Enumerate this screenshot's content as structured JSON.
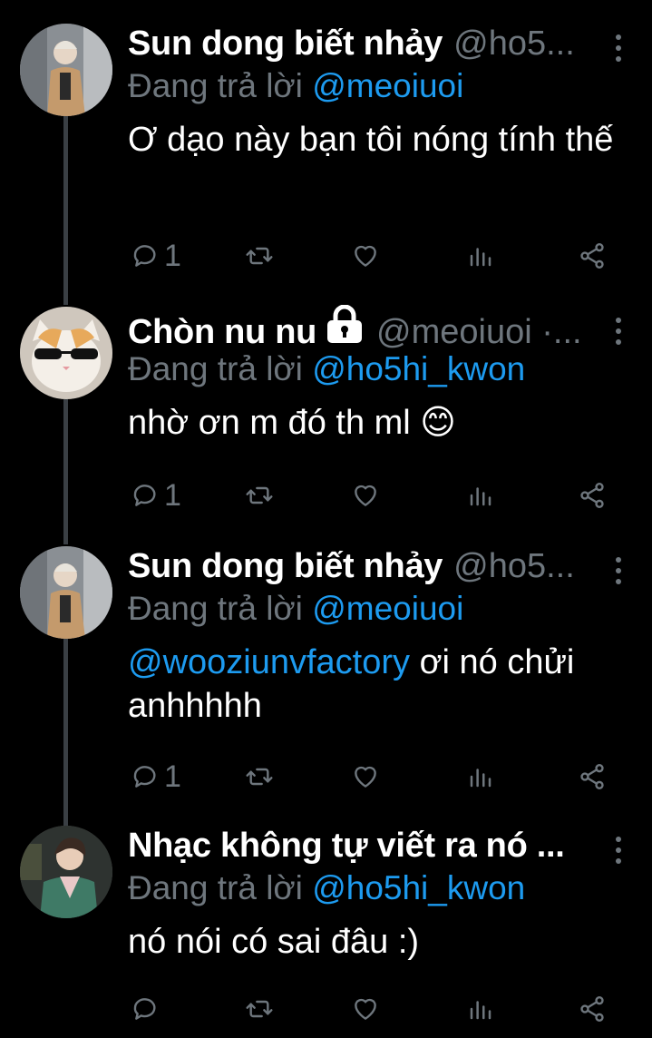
{
  "tweets": [
    {
      "name": "Sun dong biết nhảy",
      "handle": "@ho5...",
      "reply_prefix": "Đang trả lời",
      "reply_handle": "@meoiuoi",
      "text_mention": "",
      "text": "Ơ dạo này bạn tôi nóng tính thế",
      "reply_count": "1",
      "locked": false
    },
    {
      "name": "Chòn nu nu",
      "handle": "@meoiuoi ·...",
      "reply_prefix": "Đang trả lời",
      "reply_handle": "@ho5hi_kwon",
      "text_mention": "",
      "text": "nhờ ơn m đó th ml 😊",
      "reply_count": "1",
      "locked": true
    },
    {
      "name": "Sun dong biết nhảy",
      "handle": "@ho5...",
      "reply_prefix": "Đang trả lời",
      "reply_handle": "@meoiuoi",
      "text_mention": "@wooziunvfactory",
      "text": " ơi nó chửi anhhhhh",
      "reply_count": "1",
      "locked": false
    },
    {
      "name": "Nhạc không tự viết ra nó ...",
      "handle": "",
      "reply_prefix": "Đang trả lời",
      "reply_handle": "@ho5hi_kwon",
      "text_mention": "",
      "text": "nó nói có sai đâu :)",
      "reply_count": "",
      "locked": false
    }
  ],
  "colors": {
    "background": "#000000",
    "secondary_text": "#6e767d",
    "link": "#1d9bf0",
    "thread_line": "#3a3f44"
  },
  "icons": [
    "reply-icon",
    "retweet-icon",
    "like-icon",
    "views-icon",
    "share-icon",
    "more-icon",
    "lock-icon"
  ]
}
